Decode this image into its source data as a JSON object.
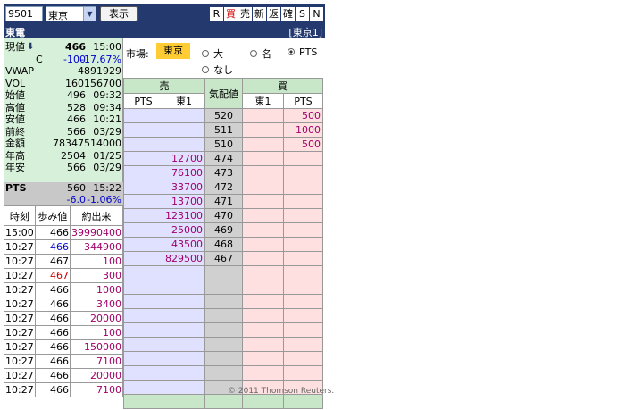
{
  "toolbar": {
    "code": "9501",
    "market": "東京",
    "show_label": "表示",
    "buttons": [
      "R",
      "買",
      "売",
      "新",
      "返",
      "確",
      "S",
      "N"
    ]
  },
  "header": {
    "name": "東電",
    "market_tag": "[東京1]"
  },
  "quote": {
    "rows": [
      {
        "label": "現値",
        "value": "466",
        "time": "15:00"
      },
      {
        "label": "C",
        "value": "-100",
        "time": "-17.67%"
      },
      {
        "label": "VWAP",
        "value": "4891929",
        "time": ""
      },
      {
        "label": "VOL",
        "value": "160156700",
        "time": ""
      },
      {
        "label": "始値",
        "value": "496",
        "time": "09:32"
      },
      {
        "label": "高値",
        "value": "528",
        "time": "09:34"
      },
      {
        "label": "安値",
        "value": "466",
        "time": "10:21"
      },
      {
        "label": "前終",
        "value": "566",
        "time": "03/29"
      },
      {
        "label": "金額",
        "value": "78347514000",
        "time": ""
      },
      {
        "label": "年高",
        "value": "2504",
        "time": "01/25"
      },
      {
        "label": "年安",
        "value": "566",
        "time": "03/29"
      }
    ],
    "pts": {
      "label": "PTS",
      "value": "560",
      "time": "15:22",
      "change": "-6.0",
      "change_pct": "-1.06%"
    }
  },
  "ticks": {
    "headers": [
      "時刻",
      "歩み値",
      "約出来"
    ],
    "rows": [
      {
        "time": "15:00",
        "price": "466",
        "vol": "39990400",
        "color": "#000000"
      },
      {
        "time": "10:27",
        "price": "466",
        "vol": "344900",
        "color": "#0000cc"
      },
      {
        "time": "10:27",
        "price": "467",
        "vol": "100",
        "color": "#000000"
      },
      {
        "time": "10:27",
        "price": "467",
        "vol": "300",
        "color": "#cc0000"
      },
      {
        "time": "10:27",
        "price": "466",
        "vol": "1000",
        "color": "#000000"
      },
      {
        "time": "10:27",
        "price": "466",
        "vol": "3400",
        "color": "#000000"
      },
      {
        "time": "10:27",
        "price": "466",
        "vol": "20000",
        "color": "#000000"
      },
      {
        "time": "10:27",
        "price": "466",
        "vol": "100",
        "color": "#000000"
      },
      {
        "time": "10:27",
        "price": "466",
        "vol": "150000",
        "color": "#000000"
      },
      {
        "time": "10:27",
        "price": "466",
        "vol": "7100",
        "color": "#000000"
      },
      {
        "time": "10:27",
        "price": "466",
        "vol": "20000",
        "color": "#000000"
      },
      {
        "time": "10:27",
        "price": "466",
        "vol": "7100",
        "color": "#000000"
      }
    ]
  },
  "market_bar": {
    "label": "市場:",
    "selected": "東京",
    "options": [
      {
        "label": "大",
        "checked": false
      },
      {
        "label": "名",
        "checked": false
      },
      {
        "label": "PTS",
        "checked": true
      },
      {
        "label": "なし",
        "checked": false
      }
    ]
  },
  "board": {
    "sell_header": "売",
    "buy_header": "買",
    "price_header": "気配値",
    "sub_headers": [
      "PTS",
      "東1",
      "東1",
      "PTS"
    ],
    "rows": [
      {
        "ask_pts": "",
        "ask": "",
        "price": "520",
        "bid": "",
        "bid_pts": "500"
      },
      {
        "ask_pts": "",
        "ask": "",
        "price": "511",
        "bid": "",
        "bid_pts": "1000"
      },
      {
        "ask_pts": "",
        "ask": "",
        "price": "510",
        "bid": "",
        "bid_pts": "500"
      },
      {
        "ask_pts": "",
        "ask": "12700",
        "price": "474",
        "bid": "",
        "bid_pts": ""
      },
      {
        "ask_pts": "",
        "ask": "76100",
        "price": "473",
        "bid": "",
        "bid_pts": ""
      },
      {
        "ask_pts": "",
        "ask": "33700",
        "price": "472",
        "bid": "",
        "bid_pts": ""
      },
      {
        "ask_pts": "",
        "ask": "13700",
        "price": "471",
        "bid": "",
        "bid_pts": ""
      },
      {
        "ask_pts": "",
        "ask": "123100",
        "price": "470",
        "bid": "",
        "bid_pts": ""
      },
      {
        "ask_pts": "",
        "ask": "25000",
        "price": "469",
        "bid": "",
        "bid_pts": ""
      },
      {
        "ask_pts": "",
        "ask": "43500",
        "price": "468",
        "bid": "",
        "bid_pts": ""
      },
      {
        "ask_pts": "",
        "ask": "829500",
        "price": "467",
        "bid": "",
        "bid_pts": ""
      },
      {
        "ask_pts": "",
        "ask": "",
        "price": "",
        "bid": "",
        "bid_pts": ""
      },
      {
        "ask_pts": "",
        "ask": "",
        "price": "",
        "bid": "",
        "bid_pts": ""
      },
      {
        "ask_pts": "",
        "ask": "",
        "price": "",
        "bid": "",
        "bid_pts": ""
      },
      {
        "ask_pts": "",
        "ask": "",
        "price": "",
        "bid": "",
        "bid_pts": ""
      },
      {
        "ask_pts": "",
        "ask": "",
        "price": "",
        "bid": "",
        "bid_pts": ""
      },
      {
        "ask_pts": "",
        "ask": "",
        "price": "",
        "bid": "",
        "bid_pts": ""
      },
      {
        "ask_pts": "",
        "ask": "",
        "price": "",
        "bid": "",
        "bid_pts": ""
      },
      {
        "ask_pts": "",
        "ask": "",
        "price": "",
        "bid": "",
        "bid_pts": ""
      },
      {
        "ask_pts": "",
        "ask": "",
        "price": "",
        "bid": "",
        "bid_pts": ""
      }
    ]
  },
  "copyright": "© 2011 Thomson Reuters."
}
